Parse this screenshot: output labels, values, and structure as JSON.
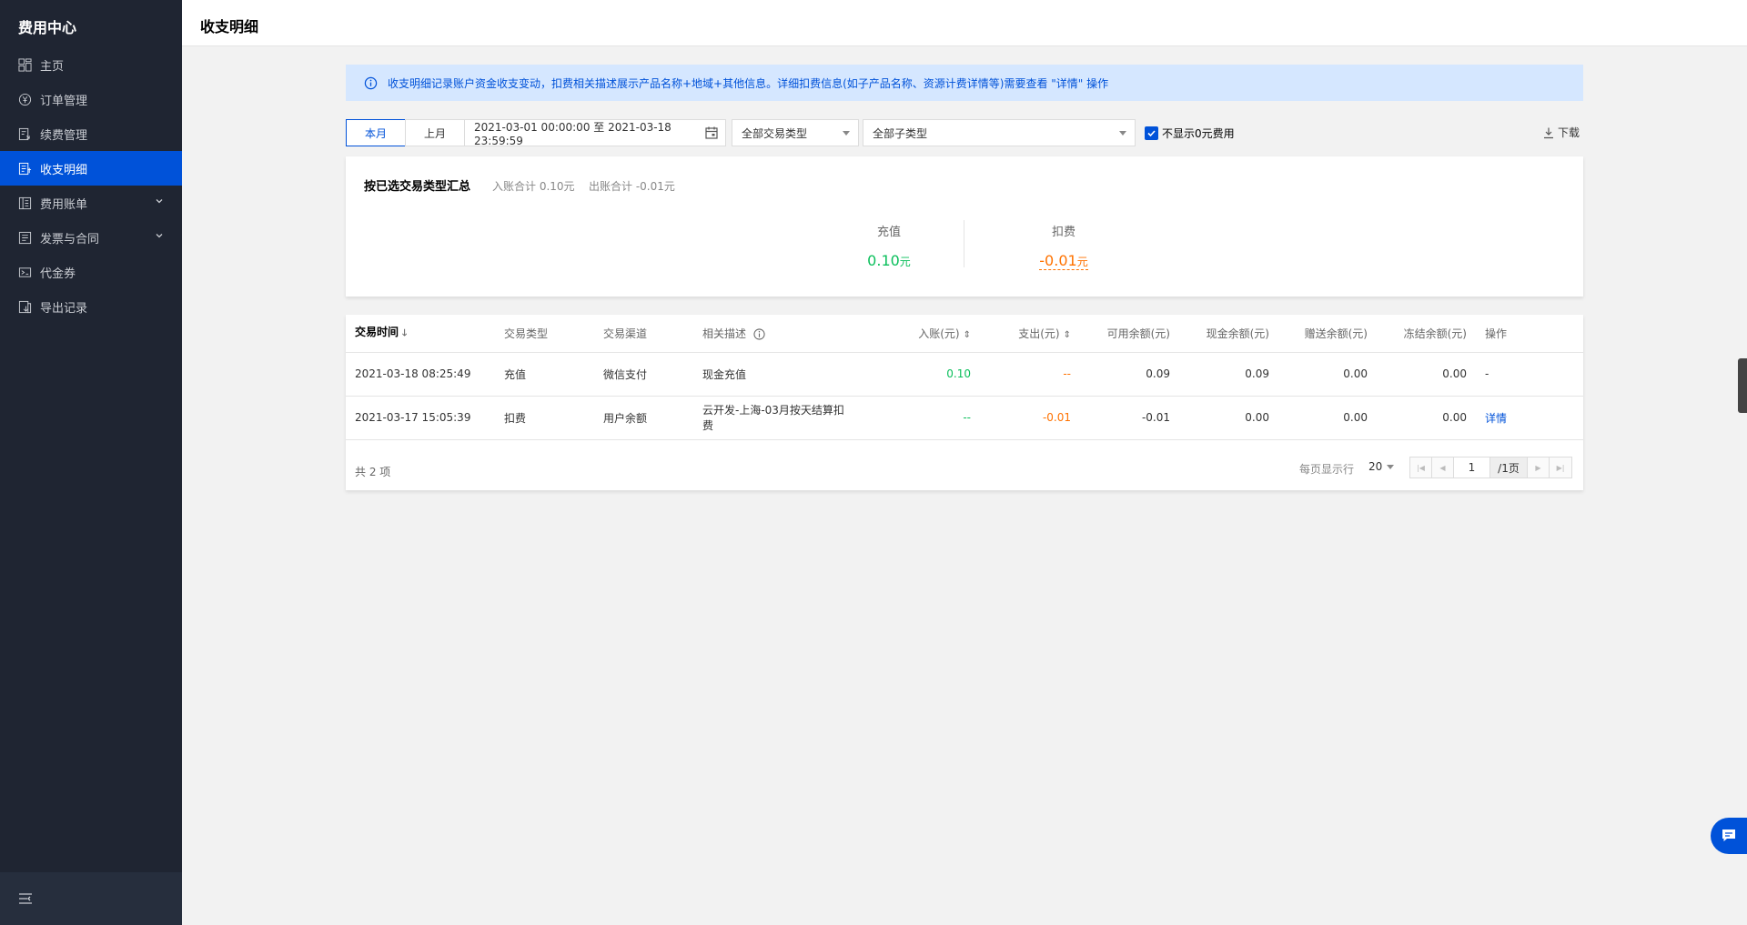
{
  "sidebar": {
    "brand": "费用中心",
    "items": [
      {
        "label": "主页",
        "icon": "grid-icon"
      },
      {
        "label": "订单管理",
        "icon": "yen-circle-icon"
      },
      {
        "label": "续费管理",
        "icon": "renew-icon"
      },
      {
        "label": "收支明细",
        "icon": "ledger-icon",
        "active": true
      },
      {
        "label": "费用账单",
        "icon": "bill-icon",
        "expandable": true
      },
      {
        "label": "发票与合同",
        "icon": "invoice-icon",
        "expandable": true
      },
      {
        "label": "代金券",
        "icon": "voucher-icon"
      },
      {
        "label": "导出记录",
        "icon": "export-icon"
      }
    ]
  },
  "header": {
    "title": "收支明细"
  },
  "notice": {
    "text": "收支明细记录账户资金收支变动，扣费相关描述展示产品名称+地域+其他信息。详细扣费信息(如子产品名称、资源计费详情等)需要查看 \"详情\" 操作"
  },
  "filters": {
    "this_month": "本月",
    "last_month": "上月",
    "date_range": "2021-03-01 00:00:00 至 2021-03-18 23:59:59",
    "trade_type": "全部交易类型",
    "sub_type": "全部子类型",
    "hide_zero_label": "不显示0元费用",
    "hide_zero_checked": true,
    "download": "下载"
  },
  "summary": {
    "title": "按已选交易类型汇总",
    "income_total": "入账合计 0.10元",
    "expense_total": "出账合计 -0.01元",
    "recharge_label": "充值",
    "recharge_value": "0.10",
    "deduct_label": "扣费",
    "deduct_value": "-0.01",
    "unit": "元"
  },
  "table": {
    "columns": [
      "交易时间",
      "交易类型",
      "交易渠道",
      "相关描述",
      "入账(元)",
      "支出(元)",
      "可用余额(元)",
      "现金余额(元)",
      "赠送余额(元)",
      "冻结余额(元)",
      "操作"
    ],
    "rows": [
      [
        "2021-03-18 08:25:49",
        "充值",
        "微信支付",
        "现金充值",
        "0.10",
        "--",
        "0.09",
        "0.09",
        "0.00",
        "0.00",
        "-"
      ],
      [
        "2021-03-17 15:05:39",
        "扣费",
        "用户余额",
        "云开发-上海-03月按天结算扣费",
        "--",
        "-0.01",
        "-0.01",
        "0.00",
        "0.00",
        "0.00",
        "详情"
      ]
    ]
  },
  "pagination": {
    "total": "共 2 项",
    "per_page_label": "每页显示行",
    "per_page": "20",
    "current_page": "1",
    "total_pages": "/1页"
  },
  "colors": {
    "accent": "#0052d9",
    "income": "#0abf5b",
    "expense": "#ff7200",
    "sidebar_bg": "#1f2532"
  }
}
